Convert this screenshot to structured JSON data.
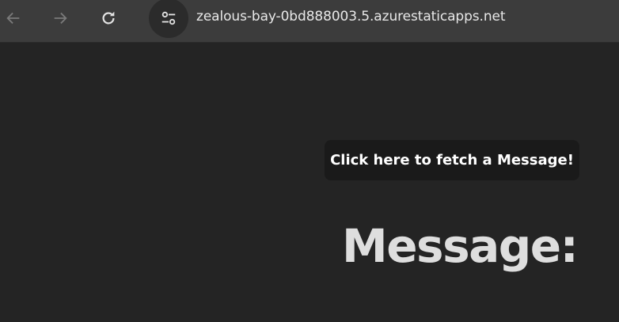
{
  "browser": {
    "url": "zealous-bay-0bd888003.5.azurestaticapps.net",
    "back_icon": "arrow-left-icon",
    "forward_icon": "arrow-right-icon",
    "reload_icon": "reload-icon",
    "site_info_icon": "tune-icon"
  },
  "page": {
    "fetch_button_label": "Click here to fetch a Message!",
    "message_heading": "Message:"
  },
  "colors": {
    "toolbar_bg": "#3c3c3c",
    "page_bg": "#242424",
    "button_bg": "#1a1a1a",
    "heading_text": "#dedede"
  }
}
